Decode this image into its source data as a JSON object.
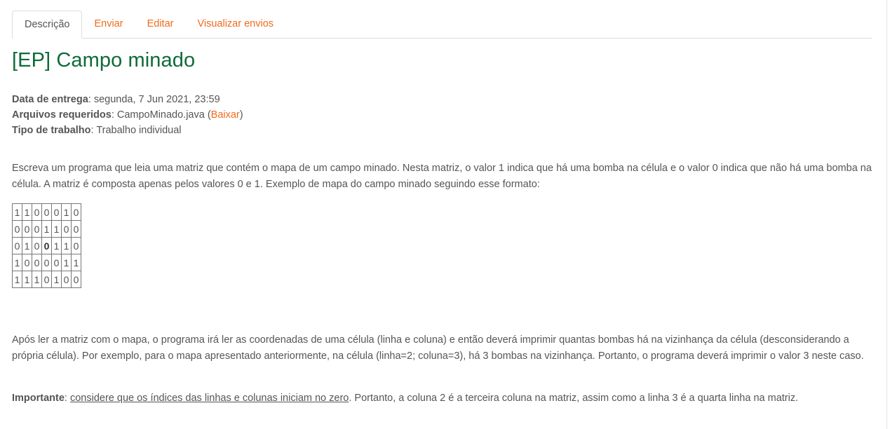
{
  "tabs": [
    {
      "label": "Descrição",
      "active": true
    },
    {
      "label": "Enviar",
      "active": false
    },
    {
      "label": "Editar",
      "active": false
    },
    {
      "label": "Visualizar envios",
      "active": false
    }
  ],
  "title": "[EP] Campo minado",
  "meta": {
    "due_label": "Data de entrega",
    "due_value": ": segunda, 7 Jun 2021, 23:59",
    "files_label": "Arquivos requeridos",
    "files_value": ": CampoMinado.java (",
    "download_link": "Baixar",
    "files_close": ")",
    "type_label": "Tipo de trabalho",
    "type_value": ": Trabalho individual"
  },
  "paragraph1": "Escreva um programa que leia uma matriz que contém o mapa de um campo minado. Nesta matriz, o valor 1 indica que há uma bomba na célula e o valor 0 indica que não há uma bomba na célula. A matriz é composta apenas pelos valores 0 e 1. Exemplo de mapa do campo minado seguindo esse formato:",
  "matrix": [
    [
      "1",
      "1",
      "0",
      "0",
      "0",
      "1",
      "0"
    ],
    [
      "0",
      "0",
      "0",
      "1",
      "1",
      "0",
      "0"
    ],
    [
      "0",
      "1",
      "0",
      "0",
      "1",
      "1",
      "0"
    ],
    [
      "1",
      "0",
      "0",
      "0",
      "0",
      "1",
      "1"
    ],
    [
      "1",
      "1",
      "1",
      "0",
      "1",
      "0",
      "0"
    ]
  ],
  "highlight_cell": {
    "row": 2,
    "col": 3
  },
  "paragraph2": "Após ler a matriz com o mapa, o programa irá ler as coordenadas de uma célula (linha e coluna) e então deverá imprimir quantas bombas há na vizinhança da célula (desconsiderando a própria célula). Por exemplo, para o mapa apresentado anteriormente, na célula (linha=2; coluna=3), há 3 bombas na vizinhança. Portanto, o programa deverá imprimir o valor 3 neste caso.",
  "important": {
    "label": "Importante",
    "separator": ": ",
    "underlined": "considere que os índices das linhas e colunas iniciam no zero",
    "rest": ". Portanto, a coluna 2 é a terceira coluna na matriz, assim como a linha 3 é a quarta linha na matriz."
  },
  "colors": {
    "accent": "#f06b1c",
    "title": "#0e6b39",
    "text": "#555555"
  }
}
